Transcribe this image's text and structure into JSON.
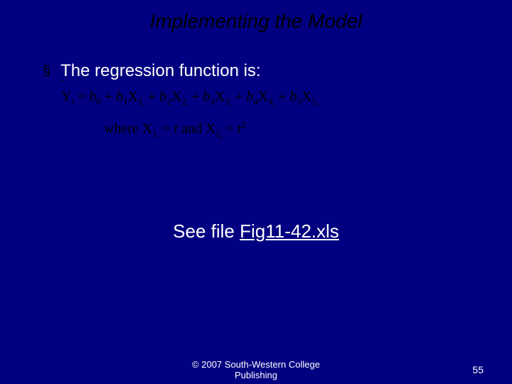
{
  "title": "Implementing the Model",
  "bullet": {
    "text": "The regression function is:"
  },
  "equation": {
    "y_hat": "Y",
    "y_sub": "t",
    "eq": " = ",
    "b0": "b",
    "b0_sub": "0",
    "plus": " + ",
    "b1": "b",
    "b1_sub": "1",
    "x1": "X",
    "x1_sub1": "1",
    "x1_sub2": "t",
    "b2": "b",
    "b2_sub": "2",
    "x2": "X",
    "x2_sub1": "2",
    "x2_sub2": "t",
    "b3": "b",
    "b3_sub": "3",
    "x3": "X",
    "x3_sub1": "3",
    "x3_sub2": "t",
    "b4": "b",
    "b4_sub": "4",
    "x4": "X",
    "x4_sub1": "4",
    "x4_sub2": "t",
    "b5": "b",
    "b5_sub": "5",
    "x5": "X",
    "x5_sub1": "5",
    "x5_sub2": "t",
    "where": "where  ",
    "wx1": "X",
    "wx1_sub1": "1",
    "wx1_sub2": "t",
    "weq1": " = ",
    "wt": "t",
    "wand": " and ",
    "wx2": "X",
    "wx2_sub1": "2",
    "wx2_sub2": "t",
    "weq2": " = ",
    "wt2": "t",
    "wt2_sup": "2"
  },
  "see_file": {
    "prefix": "See file ",
    "link": "Fig11-42.xls"
  },
  "footer": {
    "line1": "© 2007 South-Western College",
    "line2": "Publishing"
  },
  "page_number": "55"
}
